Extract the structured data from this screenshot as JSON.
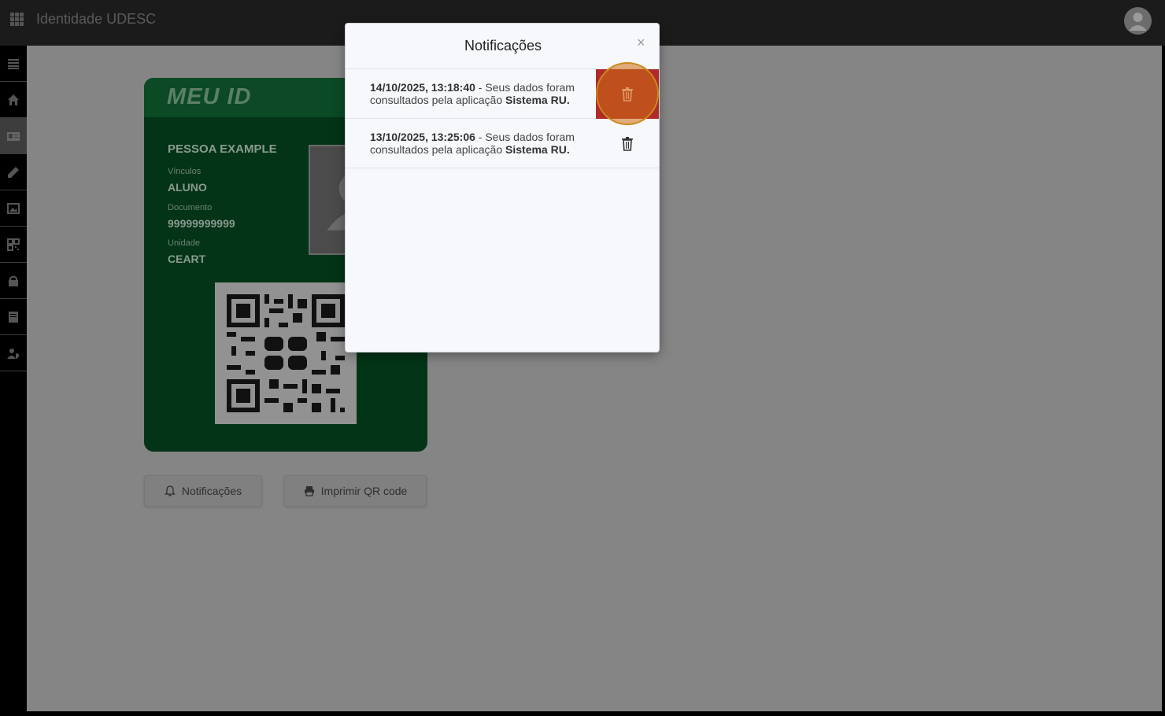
{
  "topbar": {
    "title": "Identidade UDESC",
    "menu_icon": "apps-grid-icon",
    "avatar_icon": "user-avatar-icon"
  },
  "sidebar": {
    "items": [
      {
        "icon": "list-icon"
      },
      {
        "icon": "home-icon"
      },
      {
        "icon": "id-card-icon",
        "active": true
      },
      {
        "icon": "pencil-icon"
      },
      {
        "icon": "image-icon"
      },
      {
        "icon": "qr-code-icon"
      },
      {
        "icon": "lock-icon"
      },
      {
        "icon": "book-icon"
      },
      {
        "icon": "user-shield-icon"
      }
    ]
  },
  "card": {
    "logo": "MEU ID",
    "name": "PESSOA EXAMPLE",
    "fields": [
      {
        "label": "Vínculos",
        "value": "ALUNO"
      },
      {
        "label": "Documento",
        "value": "99999999999"
      },
      {
        "label": "Unidade",
        "value": "CEART"
      }
    ]
  },
  "buttons": {
    "notifications": "Notificações",
    "print_qr": "Imprimir QR code"
  },
  "modal": {
    "title": "Notificações",
    "close": "×",
    "notifications": [
      {
        "timestamp": "14/10/2025, 13:18:40",
        "text_before": " - Seus dados foram consultados pela aplicação ",
        "app": "Sistema RU."
      },
      {
        "timestamp": "13/10/2025, 13:25:06",
        "text_before": " - Seus dados foram consultados pela aplicação ",
        "app": "Sistema RU."
      }
    ]
  },
  "colors": {
    "delete_hover": "#b02a2a",
    "card_bg": "#033417",
    "overlay": "#858585"
  }
}
